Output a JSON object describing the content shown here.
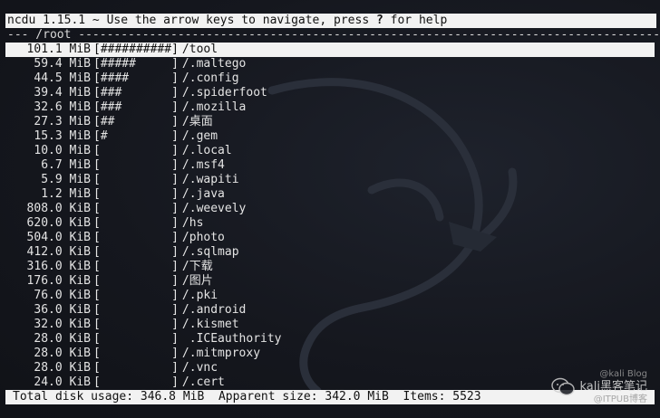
{
  "header": {
    "title_prefix": "ncdu 1.15.1 ~ Use the arrow keys to navigate, press ",
    "help_key": "?",
    "title_suffix": " for help"
  },
  "path_line": "--- /root -----------------------------------------------------------------------------------------",
  "entries": [
    {
      "size": "101.1 MiB",
      "bar": "[##########]",
      "name": "/tool",
      "selected": true
    },
    {
      "size": "59.4 MiB",
      "bar": "[#####     ]",
      "name": "/.maltego"
    },
    {
      "size": "44.5 MiB",
      "bar": "[####      ]",
      "name": "/.config"
    },
    {
      "size": "39.4 MiB",
      "bar": "[###       ]",
      "name": "/.spiderfoot"
    },
    {
      "size": "32.6 MiB",
      "bar": "[###       ]",
      "name": "/.mozilla"
    },
    {
      "size": "27.3 MiB",
      "bar": "[##        ]",
      "name": "/桌面"
    },
    {
      "size": "15.3 MiB",
      "bar": "[#         ]",
      "name": "/.gem"
    },
    {
      "size": "10.0 MiB",
      "bar": "[          ]",
      "name": "/.local"
    },
    {
      "size": "6.7 MiB",
      "bar": "[          ]",
      "name": "/.msf4"
    },
    {
      "size": "5.9 MiB",
      "bar": "[          ]",
      "name": "/.wapiti"
    },
    {
      "size": "1.2 MiB",
      "bar": "[          ]",
      "name": "/.java"
    },
    {
      "size": "808.0 KiB",
      "bar": "[          ]",
      "name": "/.weevely"
    },
    {
      "size": "620.0 KiB",
      "bar": "[          ]",
      "name": "/hs"
    },
    {
      "size": "504.0 KiB",
      "bar": "[          ]",
      "name": "/photo"
    },
    {
      "size": "412.0 KiB",
      "bar": "[          ]",
      "name": "/.sqlmap"
    },
    {
      "size": "316.0 KiB",
      "bar": "[          ]",
      "name": "/下载"
    },
    {
      "size": "176.0 KiB",
      "bar": "[          ]",
      "name": "/图片"
    },
    {
      "size": "76.0 KiB",
      "bar": "[          ]",
      "name": "/.pki"
    },
    {
      "size": "36.0 KiB",
      "bar": "[          ]",
      "name": "/.android"
    },
    {
      "size": "32.0 KiB",
      "bar": "[          ]",
      "name": "/.kismet"
    },
    {
      "size": "28.0 KiB",
      "bar": "[          ]",
      "name": " .ICEauthority"
    },
    {
      "size": "28.0 KiB",
      "bar": "[          ]",
      "name": "/.mitmproxy"
    },
    {
      "size": "28.0 KiB",
      "bar": "[          ]",
      "name": "/.vnc"
    },
    {
      "size": "24.0 KiB",
      "bar": "[          ]",
      "name": "/.cert"
    }
  ],
  "status": {
    "text": "Total disk usage: 346.8 MiB  Apparent size: 342.0 MiB  Items: 5523"
  },
  "watermark": {
    "line1": "@kali Blog",
    "line2": "kali黑客笔记",
    "line3": "@ITPUB博客"
  },
  "colors": {
    "background": "#15171e",
    "highlight": "#f2f2f2",
    "text": "#e4e4e4"
  }
}
